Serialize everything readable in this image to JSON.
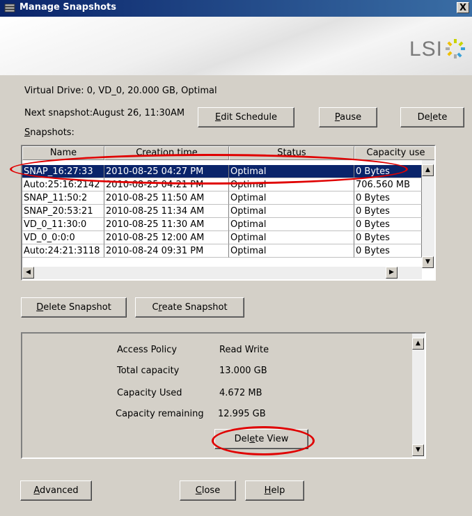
{
  "window": {
    "title": "Manage Snapshots",
    "close_glyph": "X"
  },
  "banner": {
    "logo_text": "LSI",
    "logo_mark_icon": "lsi-starburst-icon"
  },
  "info": {
    "virtual_drive": "Virtual Drive: 0, VD_0, 20.000 GB, Optimal",
    "next_snapshot": "Next snapshot:August 26, 11:30AM",
    "snapshots_label_first": "S",
    "snapshots_label_rest": "napshots:"
  },
  "buttons": {
    "edit_schedule_first": "E",
    "edit_schedule_rest": "dit Schedule",
    "pause_first": "P",
    "pause_rest": "ause",
    "delete_a": "De",
    "delete_u": "l",
    "delete_b": "ete",
    "delete_snapshot_first": "D",
    "delete_snapshot_rest": "elete Snapshot",
    "create_snapshot_a": "C",
    "create_snapshot_u": "r",
    "create_snapshot_b": "eate Snapshot",
    "delete_view_a": "Del",
    "delete_view_u": "e",
    "delete_view_b": "te View",
    "advanced_first": "A",
    "advanced_rest": "dvanced",
    "close_first": "C",
    "close_rest": "lose",
    "help_first": "H",
    "help_rest": "elp"
  },
  "table": {
    "headers": [
      "Name",
      "Creation time",
      "Status",
      "Capacity use"
    ],
    "rows": [
      [
        "SNAP_16:27:33",
        "2010-08-25 04:27 PM",
        "Optimal",
        "0 Bytes"
      ],
      [
        "Auto:25:16:2142",
        "2010-08-25 04:21 PM",
        "Optimal",
        "706.560 MB"
      ],
      [
        "SNAP_11:50:2",
        "2010-08-25 11:50 AM",
        "Optimal",
        "0 Bytes"
      ],
      [
        "SNAP_20:53:21",
        "2010-08-25 11:34 AM",
        "Optimal",
        "0 Bytes"
      ],
      [
        "VD_0_11:30:0",
        "2010-08-25 11:30 AM",
        "Optimal",
        "0 Bytes"
      ],
      [
        "VD_0_0:0:0",
        "2010-08-25 12:00 AM",
        "Optimal",
        "0 Bytes"
      ],
      [
        "Auto:24:21:3118",
        "2010-08-24 09:31 PM",
        "Optimal",
        "0 Bytes"
      ]
    ],
    "selected_row": 0
  },
  "details": {
    "access_policy_label": "Access Policy",
    "access_policy_value": "Read Write",
    "total_capacity_label": "Total capacity",
    "total_capacity_value": "13.000 GB",
    "capacity_used_label": "Capacity Used",
    "capacity_used_value": "4.672 MB",
    "capacity_remaining_label": "Capacity remaining",
    "capacity_remaining_value": "12.995 GB"
  },
  "colors": {
    "highlight": "#e00000",
    "selection": "#0a246a",
    "face": "#d4d0c8"
  }
}
